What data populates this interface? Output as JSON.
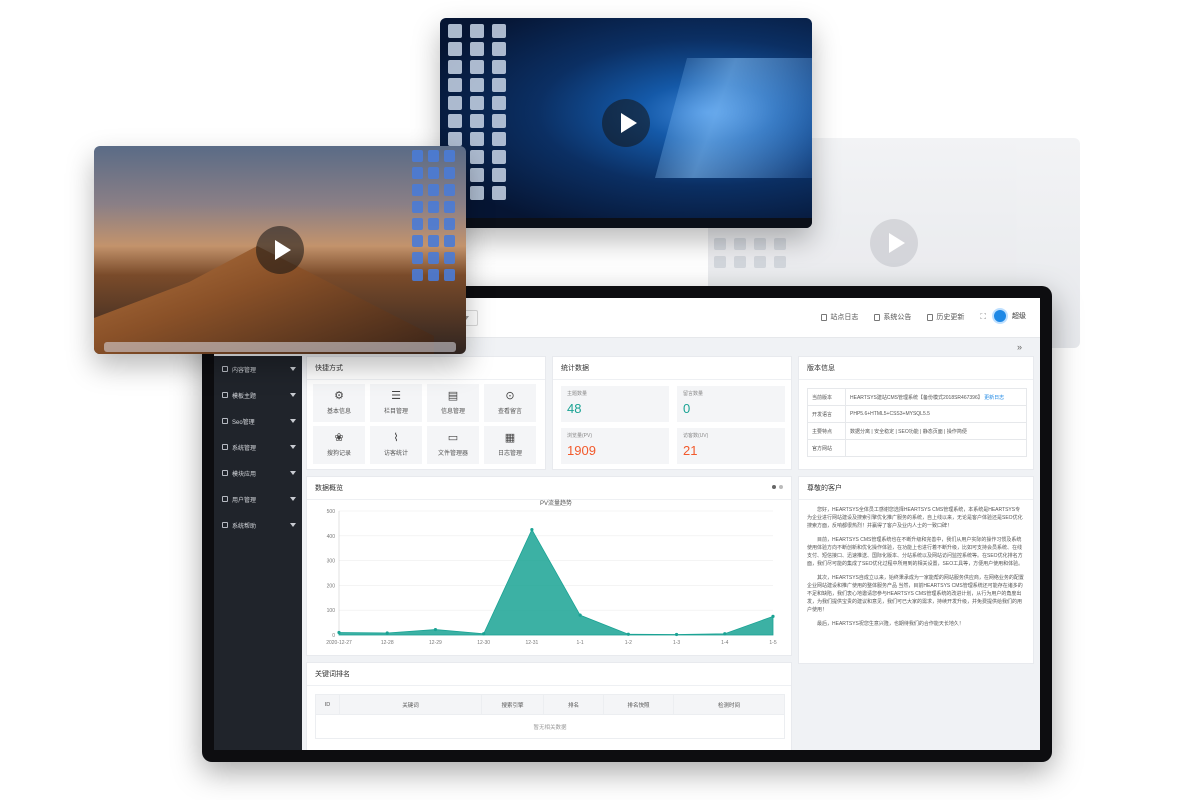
{
  "topbar": {
    "links": [
      {
        "icon": "doc-icon",
        "label": "站点日志"
      },
      {
        "icon": "bell-icon",
        "label": "系统公告"
      },
      {
        "icon": "history-icon",
        "label": "历史更新"
      }
    ],
    "expand_symbol": "⛶",
    "user_name": "超级",
    "more_symbol": "»"
  },
  "sidebar": {
    "items": [
      {
        "label": "内容管理"
      },
      {
        "label": "模板主题"
      },
      {
        "label": "Seo管理"
      },
      {
        "label": "系统管理"
      },
      {
        "label": "模块应用"
      },
      {
        "label": "用户管理"
      },
      {
        "label": "系统帮助"
      }
    ]
  },
  "quick": {
    "title": "快捷方式",
    "items": [
      {
        "icon": "gear-icon",
        "glyph": "⚙",
        "label": "基本信息"
      },
      {
        "icon": "list-icon",
        "glyph": "☰",
        "label": "栏目管理"
      },
      {
        "icon": "document-icon",
        "glyph": "▤",
        "label": "信息管理"
      },
      {
        "icon": "message-icon",
        "glyph": "⊙",
        "label": "查看留言"
      },
      {
        "icon": "paw-icon",
        "glyph": "❀",
        "label": "搜狗记录"
      },
      {
        "icon": "chart-icon",
        "glyph": "⌇",
        "label": "访客统计"
      },
      {
        "icon": "folder-icon",
        "glyph": "▭",
        "label": "文件管理器"
      },
      {
        "icon": "log-icon",
        "glyph": "▦",
        "label": "日志管理"
      }
    ]
  },
  "stats": {
    "title": "统计数据",
    "items": [
      {
        "label": "主题数量",
        "value": "48",
        "color": "#1aa394"
      },
      {
        "label": "留言数量",
        "value": "0",
        "color": "#1aa394"
      },
      {
        "label": "浏览量(PV)",
        "value": "1909",
        "color": "#f25a2c"
      },
      {
        "label": "访客数(UV)",
        "value": "21",
        "color": "#f25a2c"
      }
    ]
  },
  "version": {
    "title": "版本信息",
    "rows": [
      {
        "key": "当前版本",
        "value": "HEARTSYS建站CMS管理系统【备份模式2018SR467396】",
        "link": "更新日志"
      },
      {
        "key": "开发语言",
        "value": "PHP5.6+HTML5+CSS3+MYSQL5.5",
        "link": ""
      },
      {
        "key": "主要特点",
        "value": "数据分离 | 安全稳定 | SEO功能 | 静态页面 | 操作简便",
        "link": ""
      },
      {
        "key": "官方网站",
        "value": "",
        "link": ""
      }
    ]
  },
  "overview": {
    "title": "数据概览"
  },
  "chart_data": {
    "type": "area",
    "title": "PV流量趋势",
    "x": [
      "2020-12-27",
      "12-28",
      "12-29",
      "12-30",
      "12-31",
      "1-1",
      "1-2",
      "1-3",
      "1-4",
      "1-5"
    ],
    "series": [
      {
        "values": [
          10,
          8,
          22,
          5,
          425,
          80,
          3,
          2,
          5,
          75
        ]
      }
    ],
    "ylim": [
      0,
      500
    ],
    "yticks": [
      0,
      100,
      200,
      300,
      400,
      500
    ],
    "color": "#1aa394"
  },
  "customer": {
    "title": "尊敬的客户",
    "paragraphs": [
      "您好，HEARTSYS全体员工感谢您选择HEARTSYS CMS管理系统，本系统是HEARTSYS专为企业进行网站建设及搜索引擎优化推广服务的系统，自上线以来，无论是客户体验还是SEO优化搜索方面，反响都很热烈！并赢得了客户及业内人士的一致口碑！",
      "目前，HEARTSYS CMS管理系统也在不断升级和完善中，我们从用户实际的操作习惯及系统使用体验方向不断创新和优化操作体验，在功能上也进行着不断升级，比如可支持会员系统、在线支付、短信接口、迅速推送、国际化版本、分站系统以及网站访问监控系统等。在SEO优化排名方面，我们尽可能的集成了SEO优化过程中所用到的相关设置，SEO工具等，方便用户使用和体验。",
      "其次，HEARTSYS自成立以来，始终秉承成为一家能帮的网站服务供应商，在网络业务的配置企业网站建设和推广使用的整体服务产品 当然，目前HEARTSYS CMS管理系统还可能存在诸多的不足和缺陷，我们衷心地邀请您参与HEARTSYS CMS管理系统的改进计划，从行为用户的角度出发，为我们提供宝贵的建议和意见，我们可已大家的需求，持续开发升级，并免费提供给我们的用户使用！",
      "最后，HEARTSYS祝您生意兴隆，也期待我们的合作能天长地久！"
    ]
  },
  "keywords": {
    "title": "关键词排名",
    "columns": [
      "ID",
      "关键词",
      "搜索引擎",
      "排名",
      "排名快照",
      "检测时间"
    ],
    "empty_text": "暂无相关数据"
  }
}
